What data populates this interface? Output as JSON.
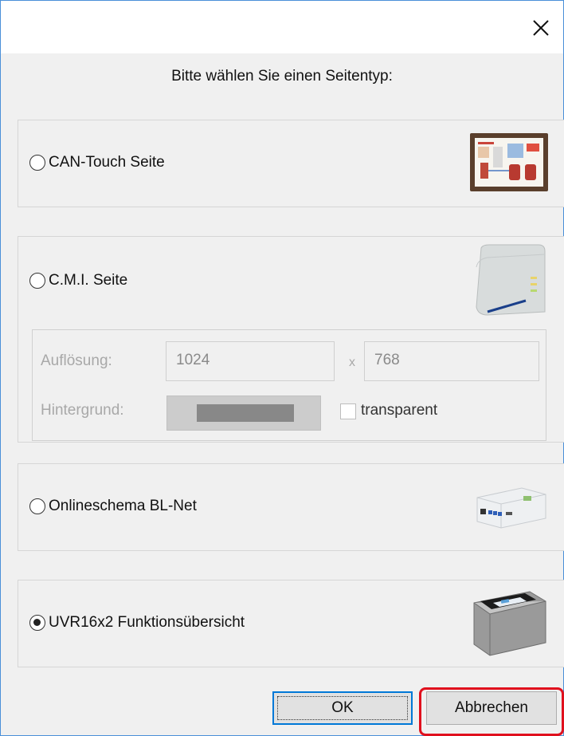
{
  "dialog": {
    "close_icon": "close-icon",
    "prompt": "Bitte wählen Sie einen Seitentyp:"
  },
  "options": [
    {
      "label": "CAN-Touch Seite",
      "selected": false,
      "icon": "can-touch-device-icon"
    },
    {
      "label": "C.M.I. Seite",
      "selected": false,
      "icon": "cmi-device-icon"
    },
    {
      "label": "Onlineschema BL-Net",
      "selected": false,
      "icon": "blnet-device-icon"
    },
    {
      "label": "UVR16x2 Funktionsübersicht",
      "selected": true,
      "icon": "uvr16x2-device-icon"
    }
  ],
  "cmi_settings": {
    "resolution_label": "Auflösung:",
    "width": "1024",
    "separator": "x",
    "height": "768",
    "background_label": "Hintergrund:",
    "background_color": "#888888",
    "transparent_label": "transparent",
    "transparent_checked": false
  },
  "buttons": {
    "ok": "OK",
    "cancel": "Abbrechen"
  },
  "colors": {
    "highlight": "#e0101d",
    "focus_border": "#0078d7"
  }
}
